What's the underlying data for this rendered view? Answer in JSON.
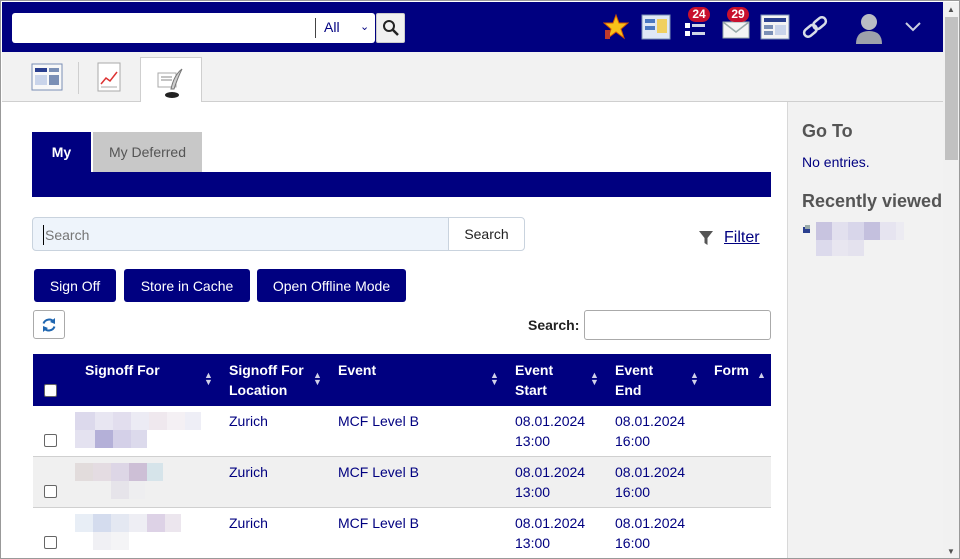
{
  "global_search": {
    "value": "",
    "scope": "All"
  },
  "badges": {
    "tasks": "24",
    "mail": "29"
  },
  "subtabs": {
    "my": "My",
    "deferred": "My Deferred"
  },
  "search": {
    "placeholder": "Search",
    "button": "Search",
    "filter_label": "Filter"
  },
  "actions": {
    "sign_off": "Sign Off",
    "store_cache": "Store in Cache",
    "offline": "Open Offline Mode"
  },
  "table": {
    "search_label": "Search:",
    "headers": [
      "Signoff For",
      "Signoff For Location",
      "Event",
      "Event Start",
      "Event End",
      "Form"
    ],
    "header_lines": {
      "location": [
        "Signoff For",
        "Location"
      ],
      "start": [
        "Event",
        "Start"
      ],
      "end": [
        "Event",
        "End"
      ]
    },
    "rows": [
      {
        "location": "Zurich",
        "event": "MCF Level B",
        "start_date": "08.01.2024",
        "start_time": "13:00",
        "end_date": "08.01.2024",
        "end_time": "16:00"
      },
      {
        "location": "Zurich",
        "event": "MCF Level B",
        "start_date": "08.01.2024",
        "start_time": "13:00",
        "end_date": "08.01.2024",
        "end_time": "16:00"
      },
      {
        "location": "Zurich",
        "event": "MCF Level B",
        "start_date": "08.01.2024",
        "start_time": "13:00",
        "end_date": "08.01.2024",
        "end_time": "16:00"
      }
    ]
  },
  "sidebar": {
    "goto_title": "Go To",
    "goto_empty": "No entries.",
    "recent_title": "Recently viewed"
  },
  "colors": {
    "brand": "#000080",
    "badge": "#c8102e"
  }
}
